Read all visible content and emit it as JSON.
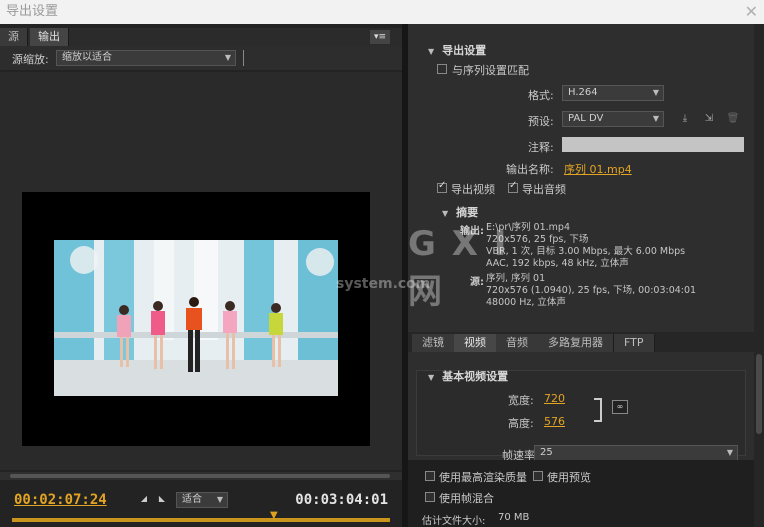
{
  "window": {
    "title": "导出设置",
    "close": "✕"
  },
  "left": {
    "tabs": [
      "源",
      "输出"
    ],
    "panel_menu": "▾≡",
    "source_scale_label": "源缩放:",
    "source_scale_value": "缩放以适合",
    "timecode_current": "00:02:07:24",
    "timecode_total": "00:03:04:01",
    "fit_value": "适合"
  },
  "export": {
    "section_title": "导出设置",
    "match_sequence_label": "与序列设置匹配",
    "format_label": "格式:",
    "format_value": "H.264",
    "preset_label": "预设:",
    "preset_value": "PAL DV",
    "comment_label": "注释:",
    "output_name_label": "输出名称:",
    "output_name_value": "序列 01.mp4",
    "export_video_label": "导出视频",
    "export_audio_label": "导出音频"
  },
  "summary": {
    "title": "摘要",
    "output_label": "输出:",
    "output_lines": [
      "E:\\pr\\序列 01.mp4",
      "720x576, 25 fps, 下场",
      "VBR, 1 次, 目标 3.00 Mbps, 最大 6.00 Mbps",
      "AAC, 192 kbps, 48 kHz, 立体声"
    ],
    "source_label": "源:",
    "source_lines": [
      "序列, 序列 01",
      "720x576 (1.0940), 25 fps, 下场, 00:03:04:01",
      "48000 Hz, 立体声"
    ]
  },
  "subtabs": [
    "滤镜",
    "视频",
    "音频",
    "多路复用器",
    "FTP"
  ],
  "video": {
    "section_title": "基本视频设置",
    "width_label": "宽度:",
    "width_value": "720",
    "height_label": "高度:",
    "height_value": "576",
    "framerate_label": "帧速率:",
    "framerate_value": "25"
  },
  "bottom": {
    "max_quality_label": "使用最高渲染质量",
    "use_preview_label": "使用预览",
    "frame_blend_label": "使用帧混合",
    "filesize_label": "估计文件大小:",
    "filesize_value": "70 MB"
  },
  "watermark": {
    "brand": "G X I 网",
    "domain": "system.com"
  }
}
